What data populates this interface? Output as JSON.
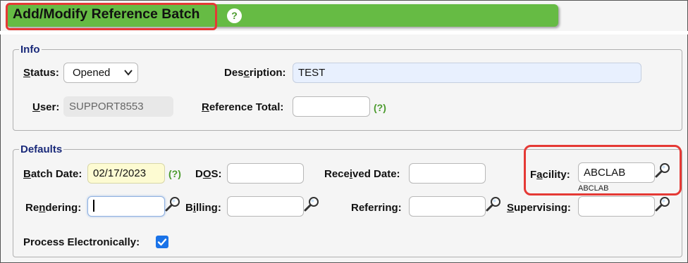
{
  "title": "Add/Modify Reference Batch",
  "help_icon_text": "?",
  "hint_text": "(?)",
  "info": {
    "legend": "Info",
    "status": {
      "label_pre": "",
      "label_u": "S",
      "label_post": "tatus:",
      "value": "Opened"
    },
    "description": {
      "label_pre": "Des",
      "label_u": "c",
      "label_post": "ription:",
      "value": "TEST"
    },
    "user": {
      "label_pre": "",
      "label_u": "U",
      "label_post": "ser:",
      "value": "SUPPORT8553"
    },
    "reference_total": {
      "label_pre": "",
      "label_u": "R",
      "label_post": "eference Total:",
      "value": ""
    }
  },
  "defaults": {
    "legend": "Defaults",
    "batch_date": {
      "label_pre": "",
      "label_u": "B",
      "label_post": "atch Date:",
      "value": "02/17/2023"
    },
    "dos": {
      "label_pre": "D",
      "label_u": "O",
      "label_post": "S:",
      "value": ""
    },
    "received_date": {
      "label_pre": "Rece",
      "label_u": "i",
      "label_post": "ved Date:",
      "value": ""
    },
    "facility": {
      "label_pre": "F",
      "label_u": "a",
      "label_post": "cility:",
      "value": "ABCLAB",
      "subtext": "ABCLAB"
    },
    "rendering": {
      "label_pre": "Re",
      "label_u": "n",
      "label_post": "dering:",
      "value": ""
    },
    "billing": {
      "label_pre": "B",
      "label_u": "i",
      "label_post": "lling:",
      "value": ""
    },
    "referring": {
      "label_pre": "Referring:",
      "label_u": "",
      "label_post": "",
      "value": ""
    },
    "supervising": {
      "label_pre": "",
      "label_u": "S",
      "label_post": "upervising:",
      "value": ""
    },
    "process_electronically": {
      "label": "Process Electronically:",
      "checked": true
    }
  },
  "colors": {
    "title_bar": "#66bb44",
    "highlight": "#e53935",
    "legend": "#1a2a7a",
    "hint": "#4a9a2c",
    "checkbox": "#1a73e8"
  }
}
